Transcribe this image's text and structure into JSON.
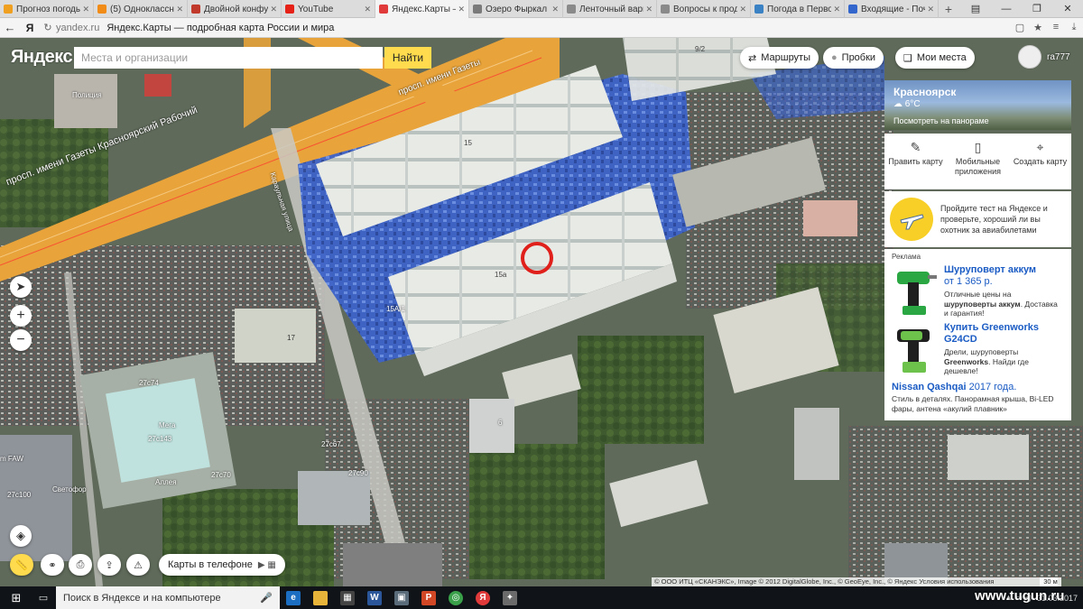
{
  "browser": {
    "tabs": [
      {
        "title": "Прогноз погоды в Пе",
        "color": "#f0a020"
      },
      {
        "title": "(5) Одноклассники",
        "color": "#f28c18"
      },
      {
        "title": "Двойной конфуз: Сас",
        "color": "#c0392b"
      },
      {
        "title": "YouTube",
        "color": "#e62117"
      },
      {
        "title": "Яндекс.Карты — п",
        "color": "#e03a3a"
      },
      {
        "title": "Озеро Фыркал - Стра",
        "color": "#7a7a7a"
      },
      {
        "title": "Ленточный вариант с",
        "color": "#8a8a8a"
      },
      {
        "title": "Вопросы к продавца",
        "color": "#8a8a8a"
      },
      {
        "title": "Погода в Первомайс",
        "color": "#3b82c4"
      },
      {
        "title": "Входящие - Почта М",
        "color": "#3366cc"
      }
    ],
    "domain": "yandex.ru",
    "page_title": "Яндекс.Карты — подробная карта России и мира"
  },
  "header": {
    "logo": "Яндекс",
    "search_placeholder": "Места и организации",
    "find_label": "Найти",
    "routes_label": "Маршруты",
    "traffic_label": "Пробки",
    "myplaces_label": "Мои места",
    "username": "ra777"
  },
  "panel": {
    "city": "Красноярск",
    "temp": "6°C",
    "panorama_link": "Посмотреть на панораме",
    "tools": [
      "Править карту",
      "Мобильные приложения",
      "Создать карту"
    ],
    "promo_text": "Пройдите тест на Яндексе и проверьте, хороший ли вы охотник за авиабилетами",
    "ads_label": "Реклама",
    "ad1": {
      "title": "Шуруповерт аккум",
      "price": "от 1 365 р.",
      "desc_pre": "Отличные цены на ",
      "desc_bold": "шуруповерты аккум",
      "desc_post": ". Доставка и гарантия!"
    },
    "ad2": {
      "title": "Купить Greenworks G24CD",
      "desc_pre": "Дрели, шуруповерты ",
      "desc_bold": "Greenworks",
      "desc_post": ". Найди где дешевле!"
    },
    "ad3": {
      "title_bold": "Nissan Qashqai",
      "title_rest": " 2017 года.",
      "desc": "Стиль в деталях. Панорамная крыша, Bi-LED фары, антена «акулий плавник»"
    }
  },
  "map_labels": {
    "street1": "просп. имени Газеты Красноярский Рабочий",
    "street2": "просп. имени Газеты",
    "street3": "Караульная улица",
    "police": "Полиция",
    "mega": "Мега",
    "alleya": "Аллея",
    "svetofor": "Светофор",
    "faw": "m FAW",
    "b15": "15",
    "b15a": "15а",
    "b15a1": "15А/1",
    "b17": "17",
    "b6": "6",
    "b92": "9/2",
    "b27c74": "27с74",
    "b27c143": "27с143",
    "b27c70": "27с70",
    "b27c90": "27с90",
    "b27c67": "27с67",
    "b27c100": "27с100"
  },
  "bottom": {
    "phone_label": "Карты в телефоне",
    "copyright": "© ООО ИТЦ «СКАНЭКС», Image © 2012 DigitalGlobe, Inc., © GeoEye, Inc., © Яндекс Условия использования",
    "scale": "30 м"
  },
  "taskbar": {
    "search_text": "Поиск в Яндексе и на компьютере",
    "time": "31.03.2017"
  },
  "watermark": "www.tugun.ru",
  "colors": {
    "accent": "#ffdb4d",
    "link": "#1a5bc4",
    "marker": "#e0201b"
  }
}
